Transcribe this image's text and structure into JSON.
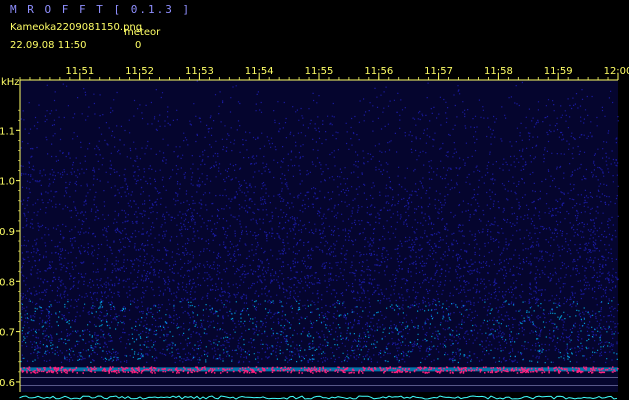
{
  "app": {
    "title": "M R O F F T  [ 0.1.3 ]"
  },
  "file": {
    "name": "Kameoka2209081150.png",
    "datetime": "22.09.08 11:50"
  },
  "meteor": {
    "label": "meteor",
    "count": "0"
  },
  "chart_data": {
    "type": "heatmap",
    "ylabel": "kHz",
    "x_ticks": [
      "11:51",
      "11:52",
      "11:53",
      "11:54",
      "11:55",
      "11:56",
      "11:57",
      "11:58",
      "11:59",
      "12:00"
    ],
    "y_ticks": [
      "1.1",
      "1.0",
      "0.9",
      "0.8",
      "0.7",
      "0.6"
    ],
    "y_tick_values": [
      1.1,
      1.0,
      0.9,
      0.8,
      0.7,
      0.6
    ],
    "xlim": [
      "11:50",
      "12:00"
    ],
    "ylim": [
      0.58,
      1.2
    ],
    "carrier_frequency": 0.625,
    "colors": {
      "background": "#000000",
      "low": "#1a1aa0",
      "mid": "#00c0ff",
      "high": "#ff2080",
      "axis": "#ffff66",
      "guide": "#c0c0ff"
    }
  }
}
